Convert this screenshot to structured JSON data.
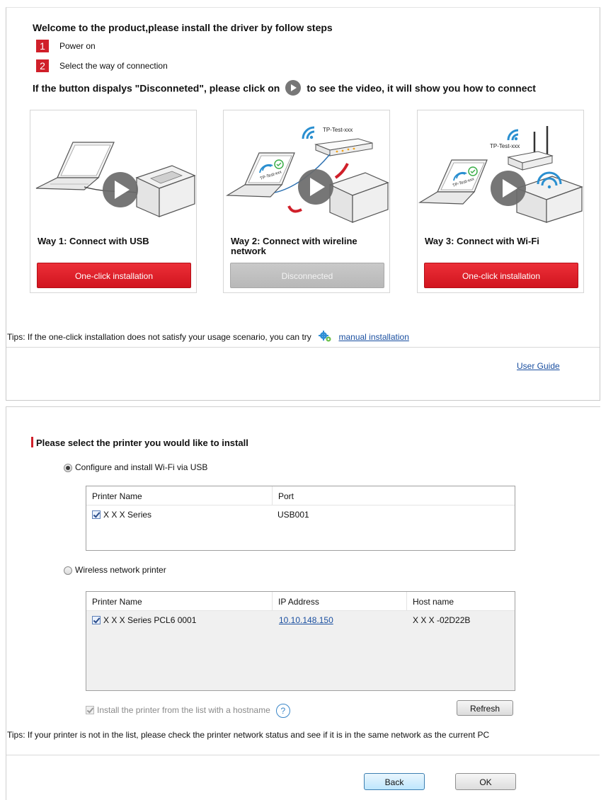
{
  "panel1": {
    "title": "Welcome to the product,please install the driver by follow steps",
    "steps": [
      {
        "num": "1",
        "label": "Power on"
      },
      {
        "num": "2",
        "label": "Select the way of connection"
      }
    ],
    "hint_before": "If the button dispalys \"Disconneted\", please click on",
    "hint_after": "to see the video, it will show you how to connect",
    "ways": [
      {
        "title": "Way 1: Connect with USB",
        "button": "One-click installation",
        "state": "enabled"
      },
      {
        "title": "Way 2: Connect with wireline network",
        "button": "Disconnected",
        "state": "disabled"
      },
      {
        "title": "Way 3: Connect with Wi-Fi",
        "button": "One-click installation",
        "state": "enabled"
      }
    ],
    "art_labels": {
      "ssid2": "TP-Test-xxx",
      "ssid3": "TP-Test-xxx",
      "laptop_ssid": "TP-Test-xxx"
    },
    "tips_text": "Tips: If the one-click installation does not satisfy your usage scenario, you can try",
    "manual_link": "manual installation",
    "user_guide": "User Guide",
    "colors": {
      "accent": "#d0202a",
      "link": "#1a4fa0"
    }
  },
  "panel2": {
    "title": "Please select the printer you would like to install",
    "option_usb": {
      "label": "Configure and install Wi-Fi via USB",
      "selected": true
    },
    "usb_table": {
      "columns": [
        "Printer Name",
        "Port"
      ],
      "rows": [
        {
          "checked": true,
          "name": "X X X  Series",
          "port": "USB001"
        }
      ]
    },
    "option_wireless": {
      "label": "Wireless network printer",
      "selected": false
    },
    "net_table": {
      "columns": [
        "Printer Name",
        "IP Address",
        "Host name"
      ],
      "rows": [
        {
          "checked": true,
          "name": "X X X  Series PCL6 0001",
          "ip": "10.10.148.150",
          "host": "X X X -02D22B"
        }
      ]
    },
    "hostname_checkbox": {
      "label": "Install the printer from the list with a hostname",
      "checked": true,
      "disabled": true
    },
    "help_icon": "?",
    "refresh": "Refresh",
    "tips": "Tips: If your printer is not in the list, please check the printer network status and see if it is in the same network as the current PC",
    "back": "Back",
    "ok": "OK"
  }
}
